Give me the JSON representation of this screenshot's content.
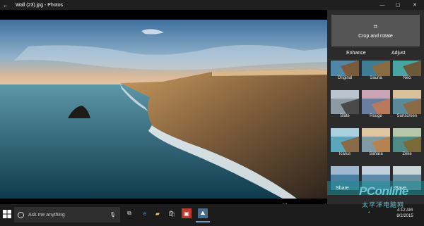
{
  "window": {
    "title": "Wall (23).jpg - Photos",
    "back_glyph": "←",
    "minimize_glyph": "—",
    "maximize_glyph": "▢",
    "close_glyph": "✕"
  },
  "viewer_controls": {
    "fit_glyph": "⛶",
    "zoom_out_glyph": "—",
    "zoom_in_glyph": "+"
  },
  "panel": {
    "crop_label": "Crop and rotate",
    "tabs": {
      "enhance": "Enhance",
      "adjust": "Adjust"
    },
    "filters": [
      [
        "Original",
        "Sauna",
        "Neo"
      ],
      [
        "Slate",
        "Rouge",
        "Sunscreen"
      ],
      [
        "Icarus",
        "Sahara",
        "Zeke"
      ],
      [
        "",
        "",
        ""
      ]
    ],
    "share_label": "Share",
    "save_label": "Save"
  },
  "taskbar": {
    "search_placeholder": "Ask me anything",
    "time": "4:12 AM",
    "date": "8/2/2015"
  },
  "watermark": {
    "brand": "PConline",
    "chinese": "太平洋电脑网"
  },
  "colors": {
    "taskbar_bg": "#1c1c1c",
    "panel_bg": "#2b2b2b",
    "accent": "#6cc6d8"
  }
}
